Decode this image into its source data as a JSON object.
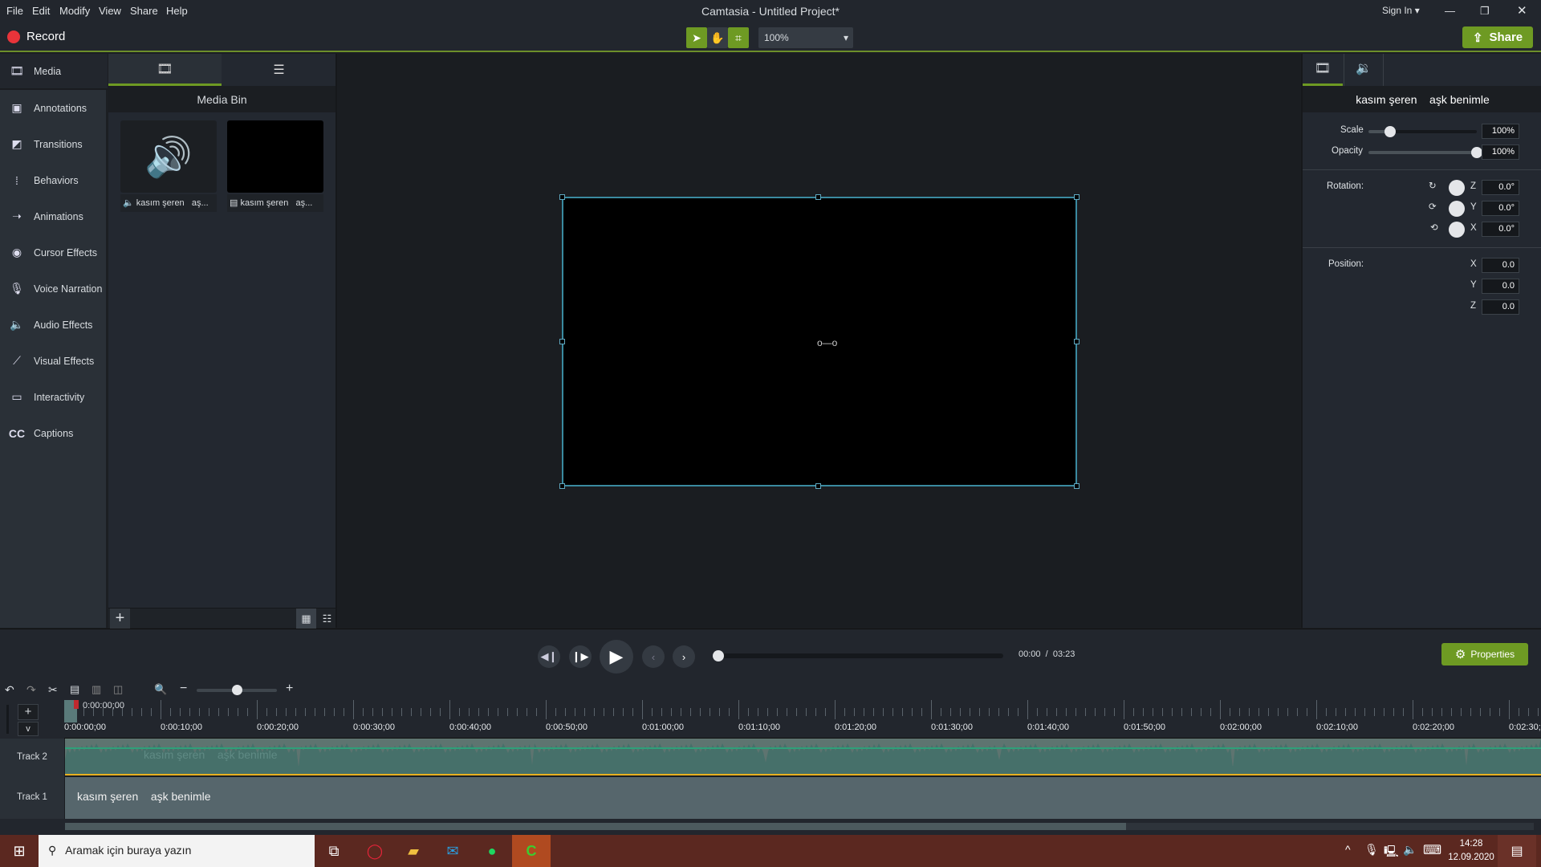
{
  "menu": [
    "File",
    "Edit",
    "Modify",
    "View",
    "Share",
    "Help"
  ],
  "window_title": "Camtasia - Untitled Project*",
  "sign_in": "Sign In",
  "record_label": "Record",
  "zoom_level": "100%",
  "share_label": "Share",
  "sidebar": [
    {
      "label": "Media",
      "icon": "film-icon"
    },
    {
      "label": "Annotations",
      "icon": "annotation-icon"
    },
    {
      "label": "Transitions",
      "icon": "transition-icon"
    },
    {
      "label": "Behaviors",
      "icon": "behaviors-icon"
    },
    {
      "label": "Animations",
      "icon": "animation-icon"
    },
    {
      "label": "Cursor Effects",
      "icon": "cursor-icon"
    },
    {
      "label": "Voice Narration",
      "icon": "microphone-icon"
    },
    {
      "label": "Audio Effects",
      "icon": "speaker-icon"
    },
    {
      "label": "Visual Effects",
      "icon": "wand-icon"
    },
    {
      "label": "Interactivity",
      "icon": "interactivity-icon"
    },
    {
      "label": "Captions",
      "icon": "cc-icon"
    }
  ],
  "bin": {
    "title": "Media Bin",
    "items": [
      {
        "name": "kasım şeren",
        "trunc": "aş...",
        "type": "audio"
      },
      {
        "name": "kasım şeren",
        "trunc": "aş...",
        "type": "video"
      }
    ]
  },
  "props": {
    "clip_title_1": "kasım şeren",
    "clip_title_2": "aşk benimle",
    "scale_label": "Scale",
    "scale": "100%",
    "scale_slider": 0.2,
    "opacity_label": "Opacity",
    "opacity": "100%",
    "opacity_slider": 1.0,
    "rotation_label": "Rotation:",
    "rot_z": "0.0°",
    "rot_y": "0.0°",
    "rot_x": "0.0°",
    "position_label": "Position:",
    "pos_x": "0.0",
    "pos_y": "0.0",
    "pos_z": "0.0",
    "axes": {
      "x": "X",
      "y": "Y",
      "z": "Z"
    }
  },
  "playback": {
    "current": "00:00",
    "sep": "/",
    "total": "03:23",
    "progress": 0
  },
  "properties_label": "Properties",
  "timeline": {
    "playhead": "0:00:00;00",
    "ticks": [
      "0:00:00;00",
      "0:00:10;00",
      "0:00:20;00",
      "0:00:30;00",
      "0:00:40;00",
      "0:00:50;00",
      "0:01:00;00",
      "0:01:10;00",
      "0:01:20;00",
      "0:01:30;00",
      "0:01:40;00",
      "0:01:50;00",
      "0:02:00;00",
      "0:02:10;00",
      "0:02:20;00",
      "0:02:30;00"
    ],
    "tracks": [
      {
        "name": "Track 2",
        "clip_1": "kasım şeren",
        "clip_2": "aşk benimle"
      },
      {
        "name": "Track 1",
        "clip_1": "kasım şeren",
        "clip_2": "aşk benimle"
      }
    ]
  },
  "taskbar": {
    "search_placeholder": "Aramak için buraya yazın",
    "time": "14:28",
    "date": "12.09.2020"
  },
  "colors": {
    "accent": "#6e9a23",
    "record": "#e8343a",
    "audio_clip": "#46706a",
    "video_clip": "#56666c"
  }
}
